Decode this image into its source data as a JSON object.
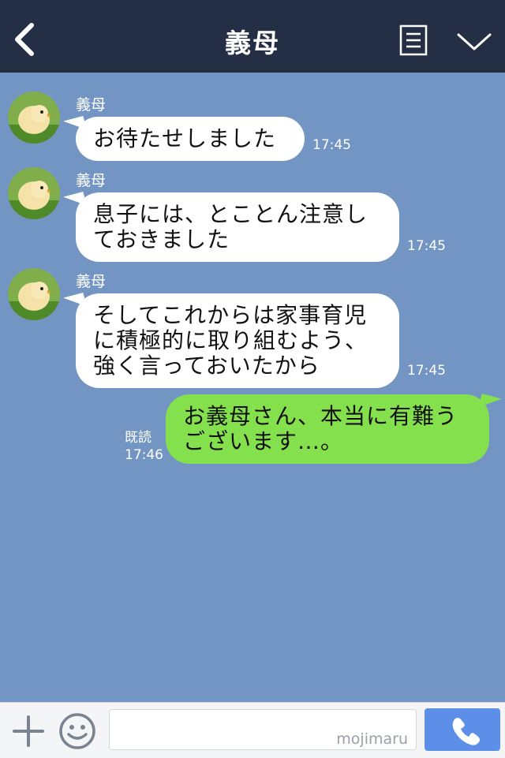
{
  "header": {
    "title": "義母",
    "back_icon": "chevron-left-icon",
    "menu_icon": "menu-icon",
    "dropdown_icon": "chevron-down-icon"
  },
  "messages": [
    {
      "sender": "義母",
      "text": "お待たせしました",
      "time": "17:45"
    },
    {
      "sender": "義母",
      "text": "息子には、とことん注意しておきました",
      "lines": [
        "息子には、とことん注意し",
        "ておきました"
      ],
      "time": "17:45"
    },
    {
      "sender": "義母",
      "text": "そしてこれからは家事育児に積極的に取り組むよう、強く言っておいたから",
      "lines": [
        "そしてこれからは家事育児",
        "に積極的に取り組むよう、",
        "強く言っておいたから"
      ],
      "time": "17:45"
    }
  ],
  "my_message": {
    "lines": [
      "お義母さん、本当に有難う",
      "ございます…。"
    ],
    "read_label": "既読",
    "time": "17:46"
  },
  "footer": {
    "watermark": "mojimaru",
    "plus_icon": "plus-icon",
    "emoji_icon": "smiley-icon",
    "call_icon": "phone-icon"
  },
  "colors": {
    "background": "#7395c3",
    "header": "#242f45",
    "my_bubble": "#84e04d",
    "their_bubble": "#ffffff",
    "call_button": "#5d8fe8"
  }
}
